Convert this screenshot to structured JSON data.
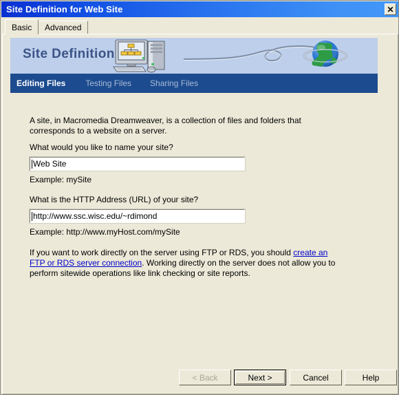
{
  "window": {
    "title": "Site Definition for Web Site",
    "close_label": "✕"
  },
  "tabs": [
    {
      "label": "Basic",
      "active": true
    },
    {
      "label": "Advanced",
      "active": false
    }
  ],
  "banner": {
    "title": "Site Definition",
    "bg_color": "#bdcfeb",
    "title_color": "#3c5487",
    "icons": [
      "computer-network-icon",
      "cable-icon",
      "globe-icon"
    ]
  },
  "steps": {
    "bg_color": "#1d4b8f",
    "items": [
      {
        "label": "Editing Files",
        "active": true
      },
      {
        "label": "Testing Files",
        "active": false
      },
      {
        "label": "Sharing Files",
        "active": false
      }
    ]
  },
  "main": {
    "intro": "A site, in Macromedia Dreamweaver, is a collection of files and folders that corresponds to a website on a server.",
    "site_name": {
      "question": "What would you like to name your site?",
      "value": "Web Site",
      "placeholder": "",
      "example": "Example: mySite"
    },
    "site_url": {
      "question": "What is the HTTP Address (URL) of your site?",
      "value": "http://www.ssc.wisc.edu/~rdimond",
      "placeholder": "",
      "example": "Example: http://www.myHost.com/mySite"
    },
    "ftp_note": {
      "before_link": "If you want to work directly on the server using FTP or RDS, you should ",
      "link_text": "create an FTP or RDS server connection",
      "after_link": ".  Working directly on the server does not allow you to perform sitewide operations like link checking or site reports.",
      "link_color": "#0000cc"
    }
  },
  "buttons": {
    "back": "< Back",
    "next": "Next >",
    "cancel": "Cancel",
    "help": "Help"
  }
}
